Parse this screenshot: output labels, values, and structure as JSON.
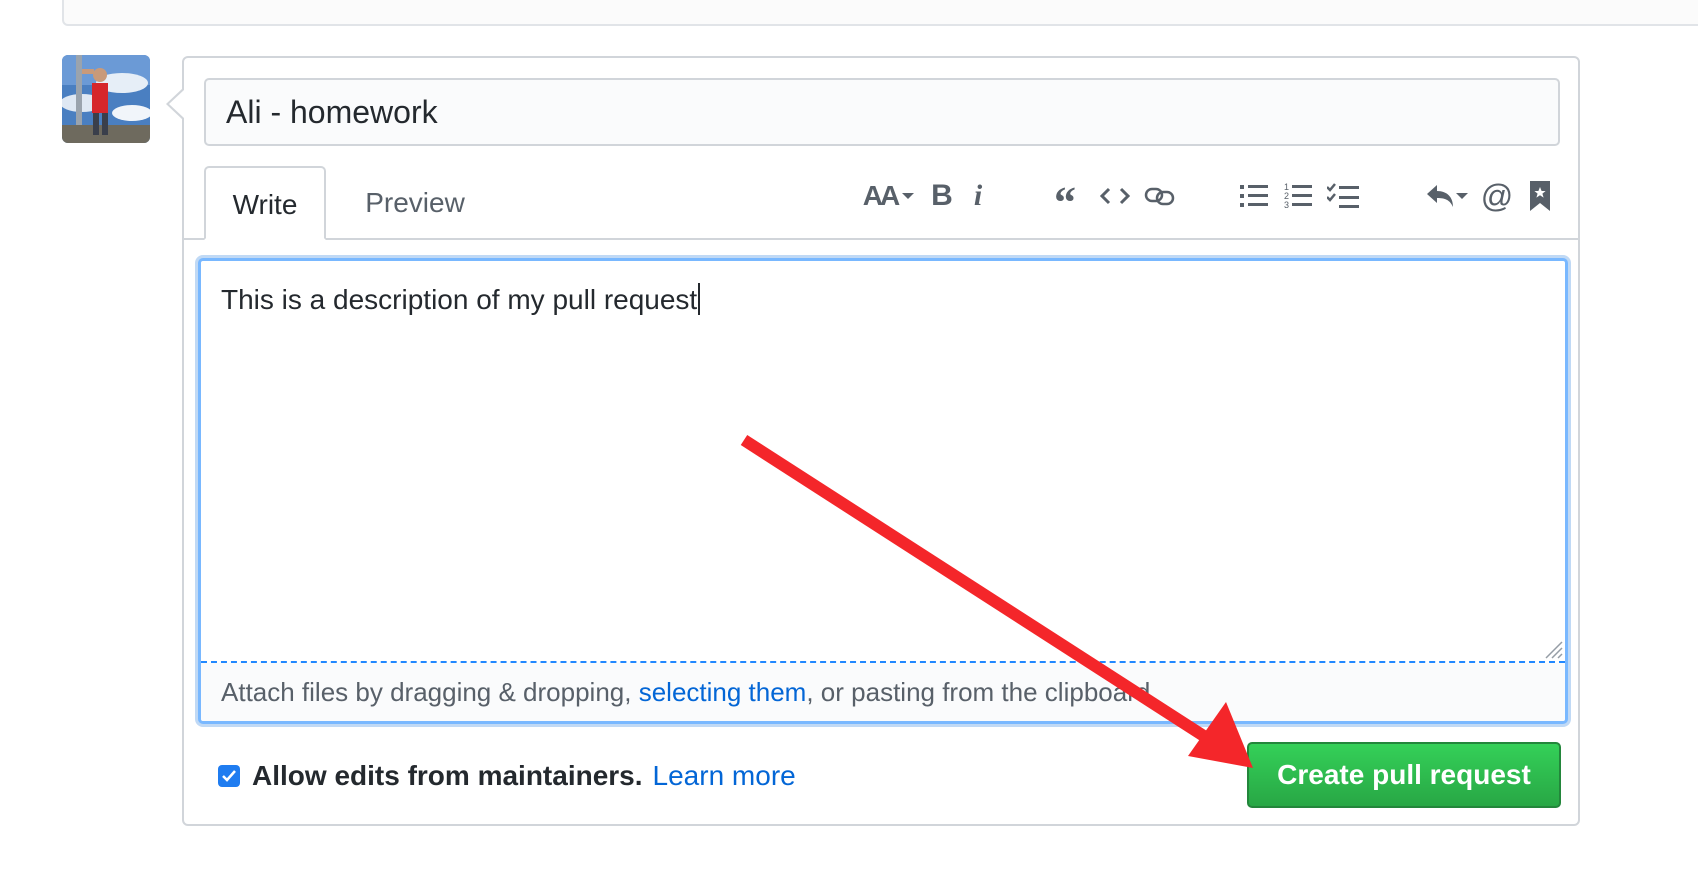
{
  "pull_request": {
    "title_value": "Ali - homework",
    "tabs": {
      "write": "Write",
      "preview": "Preview"
    },
    "toolbar": {
      "heading_glyph": "AA",
      "bold_glyph": "B",
      "italic_glyph": "i",
      "mention_glyph": "@"
    },
    "body_text": "This is a description of my pull request",
    "attach": {
      "prefix": "Attach files by dragging & dropping, ",
      "link": "selecting them",
      "suffix": ", or pasting from the clipboard."
    },
    "allow_edits": {
      "label": "Allow edits from maintainers.",
      "learn_more": "Learn more",
      "checked": true
    },
    "create_button": "Create pull request"
  },
  "icons": [
    "heading-icon",
    "bold-icon",
    "italic-icon",
    "quote-icon",
    "code-icon",
    "link-icon",
    "bulleted-list-icon",
    "numbered-list-icon",
    "task-list-icon",
    "reply-icon",
    "mention-icon",
    "bookmark-icon",
    "checkmark-icon",
    "resize-handle-icon"
  ],
  "colors": {
    "accent_blue": "#0366d6",
    "create_green": "#28a745",
    "annotation_red": "#f4262a",
    "focus_border": "#79b8ff"
  }
}
